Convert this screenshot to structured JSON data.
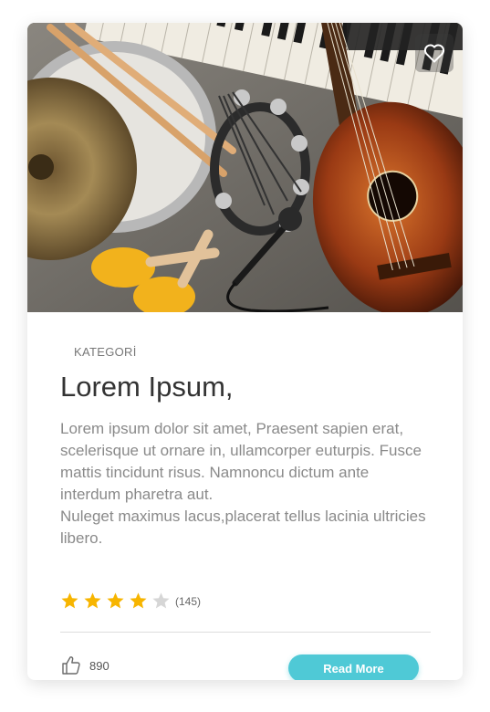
{
  "hero": {
    "favorite_icon": "heart-outline-icon"
  },
  "card": {
    "category": "KATEGORİ",
    "title": "Lorem Ipsum,",
    "description": "Lorem ipsum dolor sit amet, Praesent sapien erat, scelerisque ut ornare in, ullamcorper euturpis. Fusce mattis tincidunt risus. Namnoncu dictum ante interdum pharetra aut.\nNuleget maximus lacus,placerat tellus lacinia ultricies libero.",
    "rating": {
      "value": 4,
      "max": 5,
      "count_label": "(145)"
    },
    "likes": {
      "icon": "thumbs-up-icon",
      "count": "890"
    },
    "read_more_label": "Read More"
  },
  "colors": {
    "accent": "#4fc9d6",
    "star_filled": "#f7b500",
    "star_empty": "#d6d6d6",
    "title": "#333333",
    "text": "#8a8a8a"
  }
}
